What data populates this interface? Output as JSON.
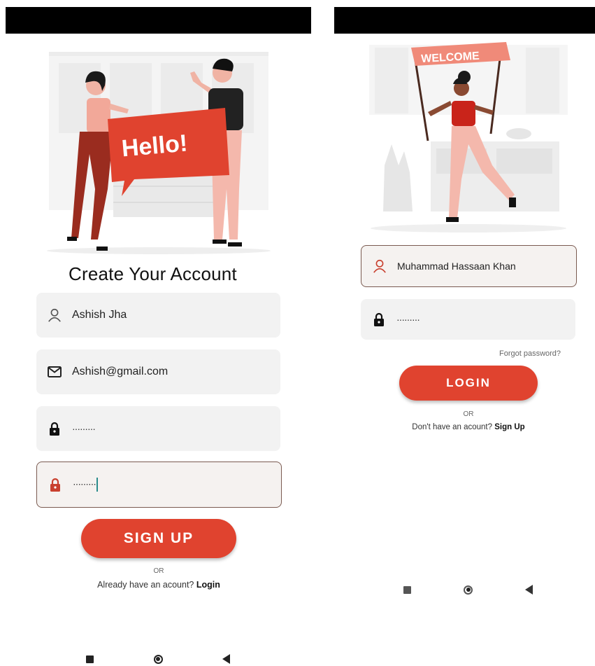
{
  "signup_screen": {
    "illustration_text": "Hello!",
    "title": "Create Your Account",
    "fields": {
      "name_value": "Ashish Jha",
      "email_value": "Ashish@gmail.com",
      "password_value": "·········",
      "confirm_password_value": "·········"
    },
    "signup_button_label": "SIGN UP",
    "or_text": "OR",
    "login_prompt": "Already have an acount?",
    "login_link": "Login"
  },
  "login_screen": {
    "banner_text": "WELCOME",
    "fields": {
      "username_value": "Muhammad Hassaan Khan",
      "password_value": "·········"
    },
    "forgot_password": "Forgot password?",
    "login_button_label": "LOGIN",
    "or_text": "OR",
    "signup_prompt": "Don't have an acount?",
    "signup_link": "Sign Up"
  },
  "colors": {
    "accent": "#e0432f",
    "field_bg": "#f2f2f2",
    "active_border": "#7a5a50",
    "status_bar": "#000000"
  },
  "icons": [
    "person-icon",
    "mail-icon",
    "lock-icon",
    "square-nav-icon",
    "home-nav-icon",
    "back-nav-icon"
  ]
}
